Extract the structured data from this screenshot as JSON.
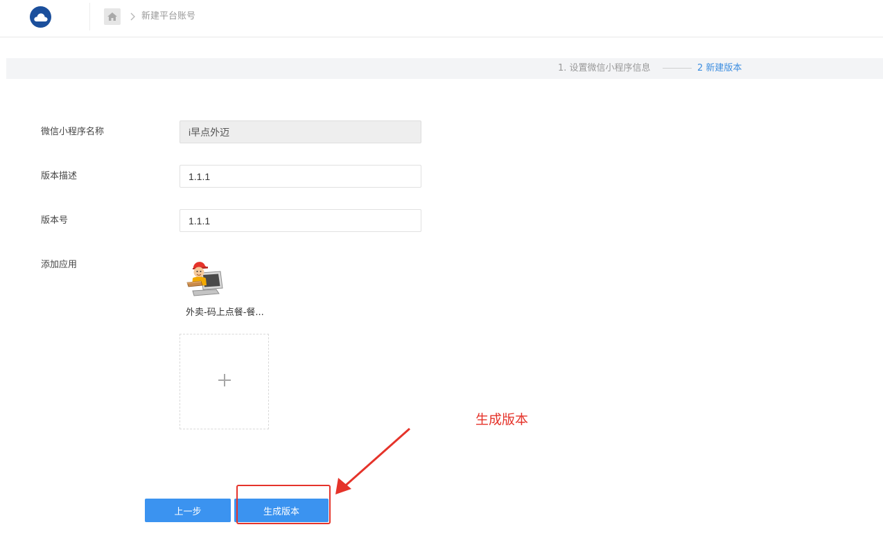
{
  "header": {
    "logo_icon": "cloud-icon",
    "home_icon": "home-icon",
    "breadcrumb_separator_icon": "chevron-right-icon",
    "breadcrumb_current": "新建平台账号"
  },
  "steps": {
    "step1_label": "1. 设置微信小程序信息",
    "step2_label": "2 新建版本",
    "active_color": "#3d8ee0",
    "inactive_color": "#999999"
  },
  "form": {
    "name_label": "微信小程序名称",
    "name_value": "i早点外迈",
    "desc_label": "版本描述",
    "desc_value": "1.1.1",
    "version_label": "版本号",
    "version_value": "1.1.1",
    "apps_label": "添加应用",
    "apps": [
      {
        "name": "外卖-码上点餐-餐...",
        "icon": "delivery-app-icon"
      }
    ],
    "add_app_icon": "plus-icon"
  },
  "actions": {
    "prev_label": "上一步",
    "generate_label": "生成版本",
    "button_color": "#3b93f0"
  },
  "annotation": {
    "text": "生成版本",
    "color": "#e5332a"
  }
}
